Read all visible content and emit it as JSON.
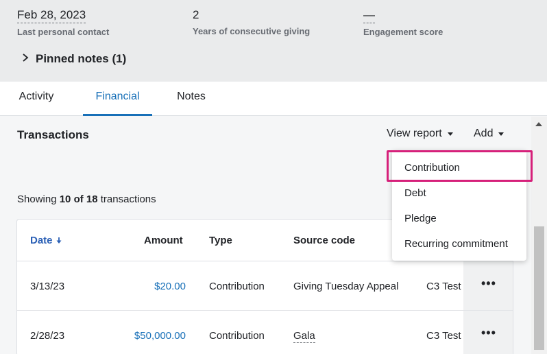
{
  "summary": {
    "last_contact": {
      "value": "Feb 28, 2023",
      "label": "Last personal contact"
    },
    "consecutive_giving": {
      "value": "2",
      "label": "Years of consecutive giving"
    },
    "engagement": {
      "value": "—",
      "label": "Engagement score"
    },
    "pinned_notes": "Pinned notes (1)"
  },
  "tabs": [
    {
      "label": "Activity",
      "active": false
    },
    {
      "label": "Financial",
      "active": true
    },
    {
      "label": "Notes",
      "active": false
    }
  ],
  "transactions": {
    "title": "Transactions",
    "view_report_label": "View report",
    "add_label": "Add",
    "showing_prefix": "Showing",
    "showing_count": "10 of 18",
    "showing_suffix": "transactions",
    "columns": {
      "date": "Date",
      "amount": "Amount",
      "type": "Type",
      "source_code": "Source code"
    },
    "rows": [
      {
        "date": "3/13/23",
        "amount": "$20.00",
        "type": "Contribution",
        "source_code": "Giving Tuesday Appeal",
        "extra": "C3 Test"
      },
      {
        "date": "2/28/23",
        "amount": "$50,000.00",
        "type": "Contribution",
        "source_code": "Gala",
        "extra": "C3 Test"
      }
    ]
  },
  "add_menu": {
    "items": [
      "Contribution",
      "Debt",
      "Pledge",
      "Recurring commitment"
    ],
    "highlighted": "Contribution"
  },
  "colors": {
    "accent": "#1870b8",
    "highlight": "#d6207a"
  },
  "icons": {
    "sort": "arrow-down-icon",
    "more": "ellipsis-icon"
  }
}
